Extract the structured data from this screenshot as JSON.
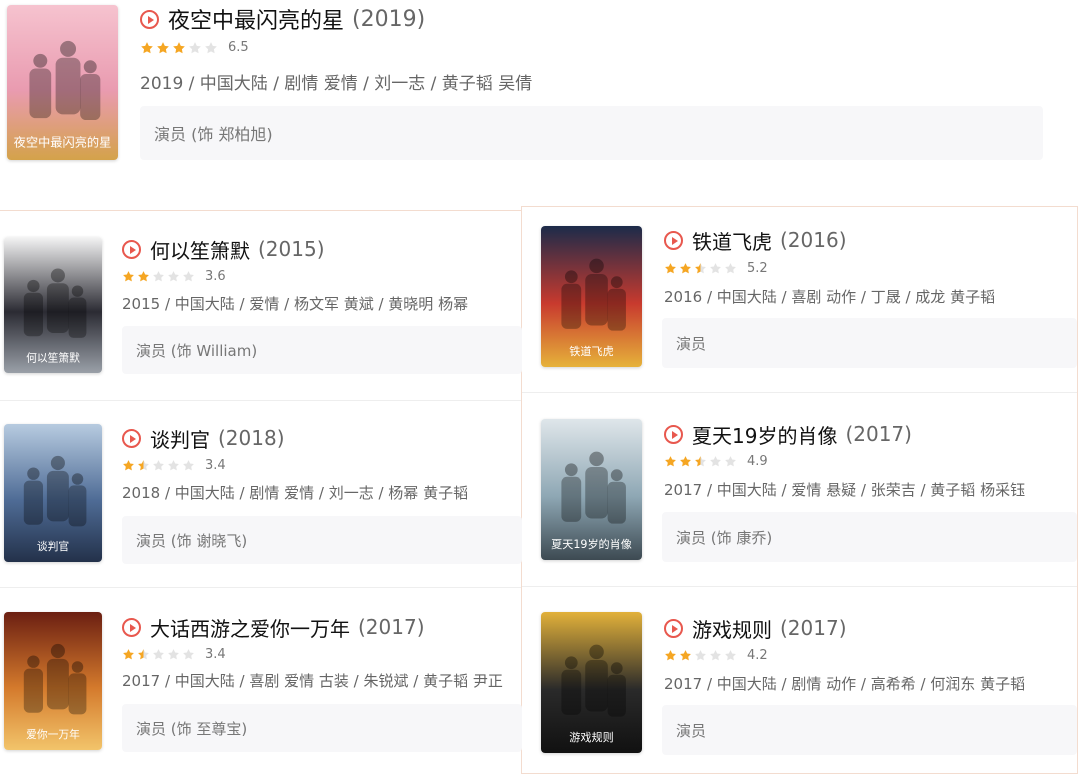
{
  "films": [
    {
      "title": "夜空中最闪亮的星",
      "year": "(2019)",
      "rating": "6.5",
      "stars": [
        1,
        1,
        1,
        0,
        0
      ],
      "meta": "2019 / 中国大陆 / 剧情 爱情 / 刘一志 / 黄子韬 吴倩",
      "role": "演员 (饰 郑柏旭)",
      "poster_text": "夜空中最闪亮的星",
      "poster_colors": [
        "#f6c3cf",
        "#e99bb0",
        "#d4a24a"
      ]
    },
    {
      "title": "何以笙箫默",
      "year": "(2015)",
      "rating": "3.6",
      "stars": [
        1,
        1,
        0,
        0,
        0
      ],
      "meta": "2015 / 中国大陆 / 爱情 / 杨文军 黄斌 / 黄晓明 杨幂",
      "role": "演员 (饰 William)",
      "poster_text": "何以笙箫默",
      "poster_colors": [
        "#f4f4f4",
        "#2b2b33",
        "#9aa0a8"
      ]
    },
    {
      "title": "铁道飞虎",
      "year": "(2016)",
      "rating": "5.2",
      "stars": [
        1,
        1,
        0.5,
        0,
        0
      ],
      "meta": "2016 / 中国大陆 / 喜剧 动作 / 丁晟 / 成龙 黄子韬",
      "role": "演员",
      "poster_text": "铁道飞虎",
      "poster_colors": [
        "#1c2b4a",
        "#c83a2e",
        "#e6b23a"
      ]
    },
    {
      "title": "谈判官",
      "year": "(2018)",
      "rating": "3.4",
      "stars": [
        1,
        0.5,
        0,
        0,
        0
      ],
      "meta": "2018 / 中国大陆 / 剧情 爱情 / 刘一志 / 杨幂 黄子韬",
      "role": "演员 (饰 谢晓飞)",
      "poster_text": "谈判官",
      "poster_colors": [
        "#b7cbe0",
        "#4f6c96",
        "#23314a"
      ]
    },
    {
      "title": "夏天19岁的肖像",
      "year": "(2017)",
      "rating": "4.9",
      "stars": [
        1,
        1,
        0.5,
        0,
        0
      ],
      "meta": "2017 / 中国大陆 / 爱情 悬疑 / 张荣吉 / 黄子韬 杨采钰",
      "role": "演员 (饰 康乔)",
      "poster_text": "夏天19岁的肖像",
      "poster_colors": [
        "#dfe6ea",
        "#8ea7b4",
        "#3d4a52"
      ]
    },
    {
      "title": "大话西游之爱你一万年",
      "year": "(2017)",
      "rating": "3.4",
      "stars": [
        1,
        0.5,
        0,
        0,
        0
      ],
      "meta": "2017 / 中国大陆 / 喜剧 爱情 古装 / 朱锐斌 / 黄子韬 尹正",
      "role": "演员 (饰 至尊宝)",
      "poster_text": "爱你一万年",
      "poster_colors": [
        "#6b1f12",
        "#d47a2c",
        "#f2c46a"
      ]
    },
    {
      "title": "游戏规则",
      "year": "(2017)",
      "rating": "4.2",
      "stars": [
        1,
        1,
        0,
        0,
        0
      ],
      "meta": "2017 / 中国大陆 / 剧情 动作 / 高希希 / 何润东 黄子韬",
      "role": "演员",
      "poster_text": "游戏规则",
      "poster_colors": [
        "#e2b13a",
        "#2a2a2a",
        "#111111"
      ]
    }
  ],
  "colors": {
    "accent": "#e8584e",
    "star_on": "#f5a623",
    "star_off": "#e3e3e3"
  }
}
